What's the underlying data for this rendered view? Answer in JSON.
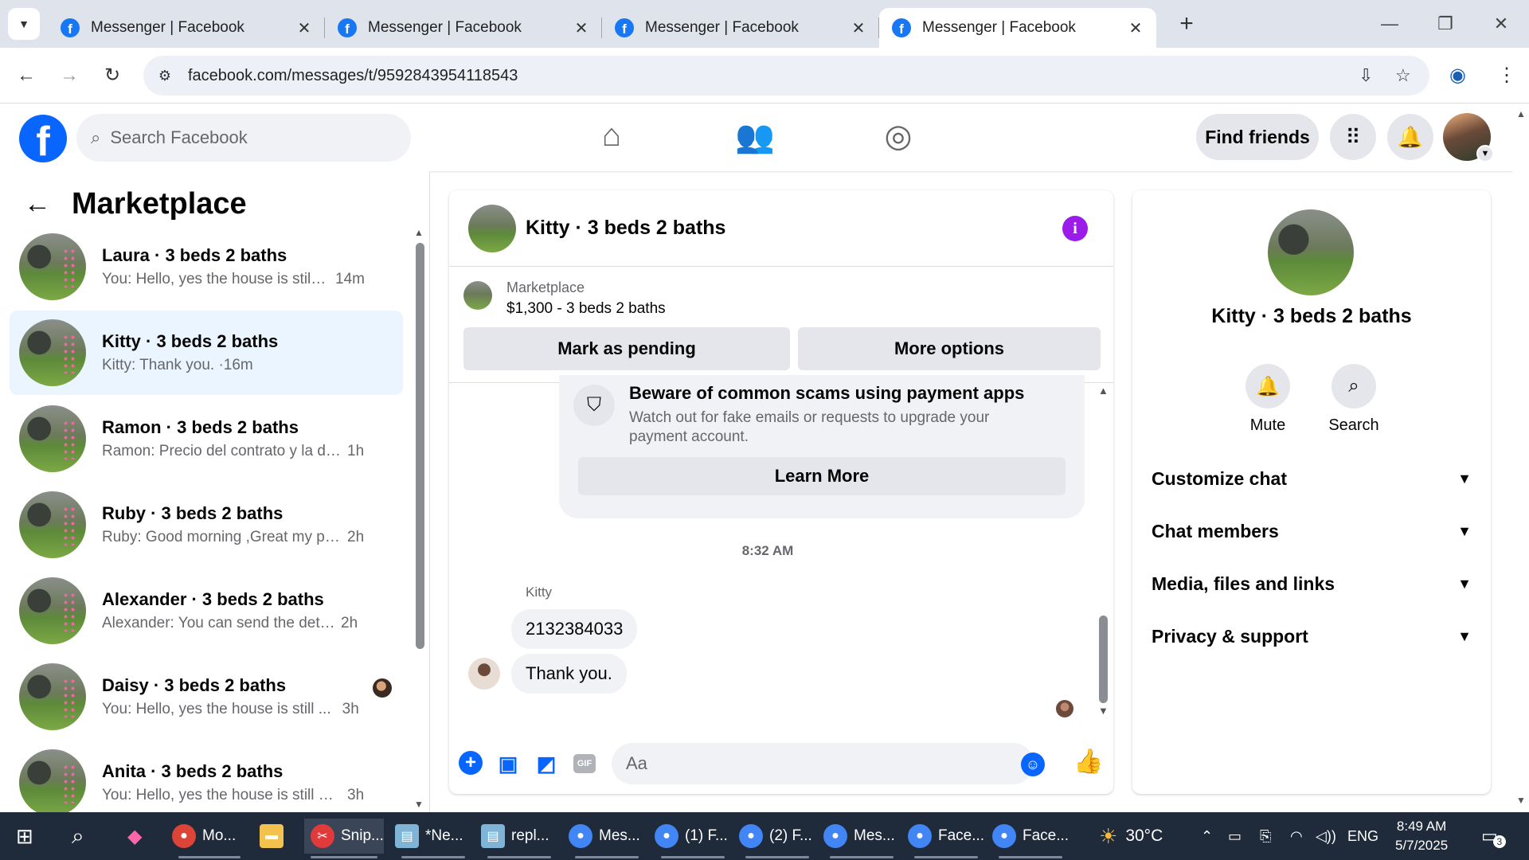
{
  "browser": {
    "tabs": [
      {
        "title": "Messenger | Facebook",
        "active": false
      },
      {
        "title": "Messenger | Facebook",
        "active": false
      },
      {
        "title": "Messenger | Facebook",
        "active": false
      },
      {
        "title": "Messenger | Facebook",
        "active": true
      }
    ],
    "url": "facebook.com/messages/t/9592843954118543"
  },
  "fb": {
    "search_placeholder": "Search Facebook",
    "find_friends": "Find friends"
  },
  "sidebar": {
    "title": "Marketplace",
    "conversations": [
      {
        "name": "Laura · 3 beds 2 baths",
        "preview": "You: Hello, yes the house is still a...",
        "time": "14m"
      },
      {
        "name": "Kitty · 3 beds 2 baths",
        "preview": "Kitty: Thank you. ·",
        "time": "16m"
      },
      {
        "name": "Ramon · 3 beds 2 baths",
        "preview": "Ramon: Precio del contrato y la dir...",
        "time": "1h"
      },
      {
        "name": "Ruby · 3 beds 2 baths",
        "preview": "Ruby: Good morning ,Great my ph...",
        "time": "2h"
      },
      {
        "name": "Alexander · 3 beds 2 baths",
        "preview": "Alexander: You can send the details... ·",
        "time": "2h"
      },
      {
        "name": "Daisy · 3 beds 2 baths",
        "preview": "You: Hello, yes the house is still ...",
        "time": "3h"
      },
      {
        "name": "Anita · 3 beds 2 baths",
        "preview": "You: Hello, yes the house is still ava...",
        "time": "3h"
      }
    ]
  },
  "chat": {
    "title": "Kitty · 3 beds 2 baths",
    "marketplace_label": "Marketplace",
    "listing": "$1,300 - 3 beds 2 baths",
    "mark_pending": "Mark as pending",
    "more_options": "More options",
    "scam_title": "Beware of common scams using payment apps",
    "scam_body": "Watch out for fake emails or requests to upgrade your payment account.",
    "learn_more": "Learn More",
    "timestamp": "8:32 AM",
    "sender": "Kitty",
    "messages": [
      "2132384033",
      "Thank you."
    ],
    "composer_placeholder": "Aa"
  },
  "info": {
    "name": "Kitty · 3 beds 2 baths",
    "mute": "Mute",
    "search": "Search",
    "sections": [
      "Customize chat",
      "Chat members",
      "Media, files and links",
      "Privacy & support"
    ]
  },
  "taskbar": {
    "items": [
      {
        "label": "Mo...",
        "icon": "chrome-profile-icon"
      },
      {
        "label": "",
        "icon": "file-explorer-icon"
      },
      {
        "label": "Snip...",
        "icon": "snipping-tool-icon"
      },
      {
        "label": "*Ne...",
        "icon": "notepad-icon"
      },
      {
        "label": "repl...",
        "icon": "notepad-icon"
      },
      {
        "label": "Mes...",
        "icon": "chrome-icon"
      },
      {
        "label": "(1) F...",
        "icon": "chrome-icon"
      },
      {
        "label": "(2) F...",
        "icon": "chrome-icon"
      },
      {
        "label": "Mes...",
        "icon": "chrome-icon"
      },
      {
        "label": "Face...",
        "icon": "chrome-icon"
      },
      {
        "label": "Face...",
        "icon": "chrome-icon"
      }
    ],
    "weather": "30°C",
    "lang": "ENG",
    "time": "8:49 AM",
    "date": "5/7/2025",
    "notifications": "3"
  }
}
